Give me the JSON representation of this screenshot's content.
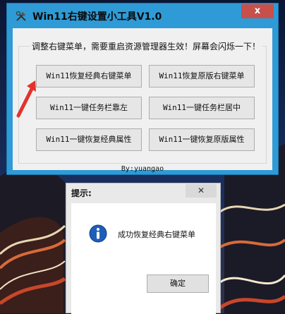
{
  "window": {
    "title": "Win11右键设置小工具V1.0",
    "close_glyph": "x",
    "group_title": "调整右键菜单，需要重启资源管理器生效！屏幕会闪烁一下！",
    "buttons": [
      "Win11恢复经典右键菜单",
      "Win11恢复原版右键菜单",
      "Win11一键任务栏靠左",
      "Win11一键任务栏居中",
      "Win11一键恢复经典属性",
      "Win11一键恢复原版属性"
    ],
    "footer": "By:yuangao"
  },
  "dialog": {
    "title": "提示:",
    "close_glyph": "✕",
    "message": "成功恢复经典右键菜单",
    "ok_label": "确定"
  },
  "colors": {
    "titlebar": "#2f9bd6",
    "close": "#c7504a",
    "arrow": "#e4322b",
    "info": "#1d5fb8"
  }
}
